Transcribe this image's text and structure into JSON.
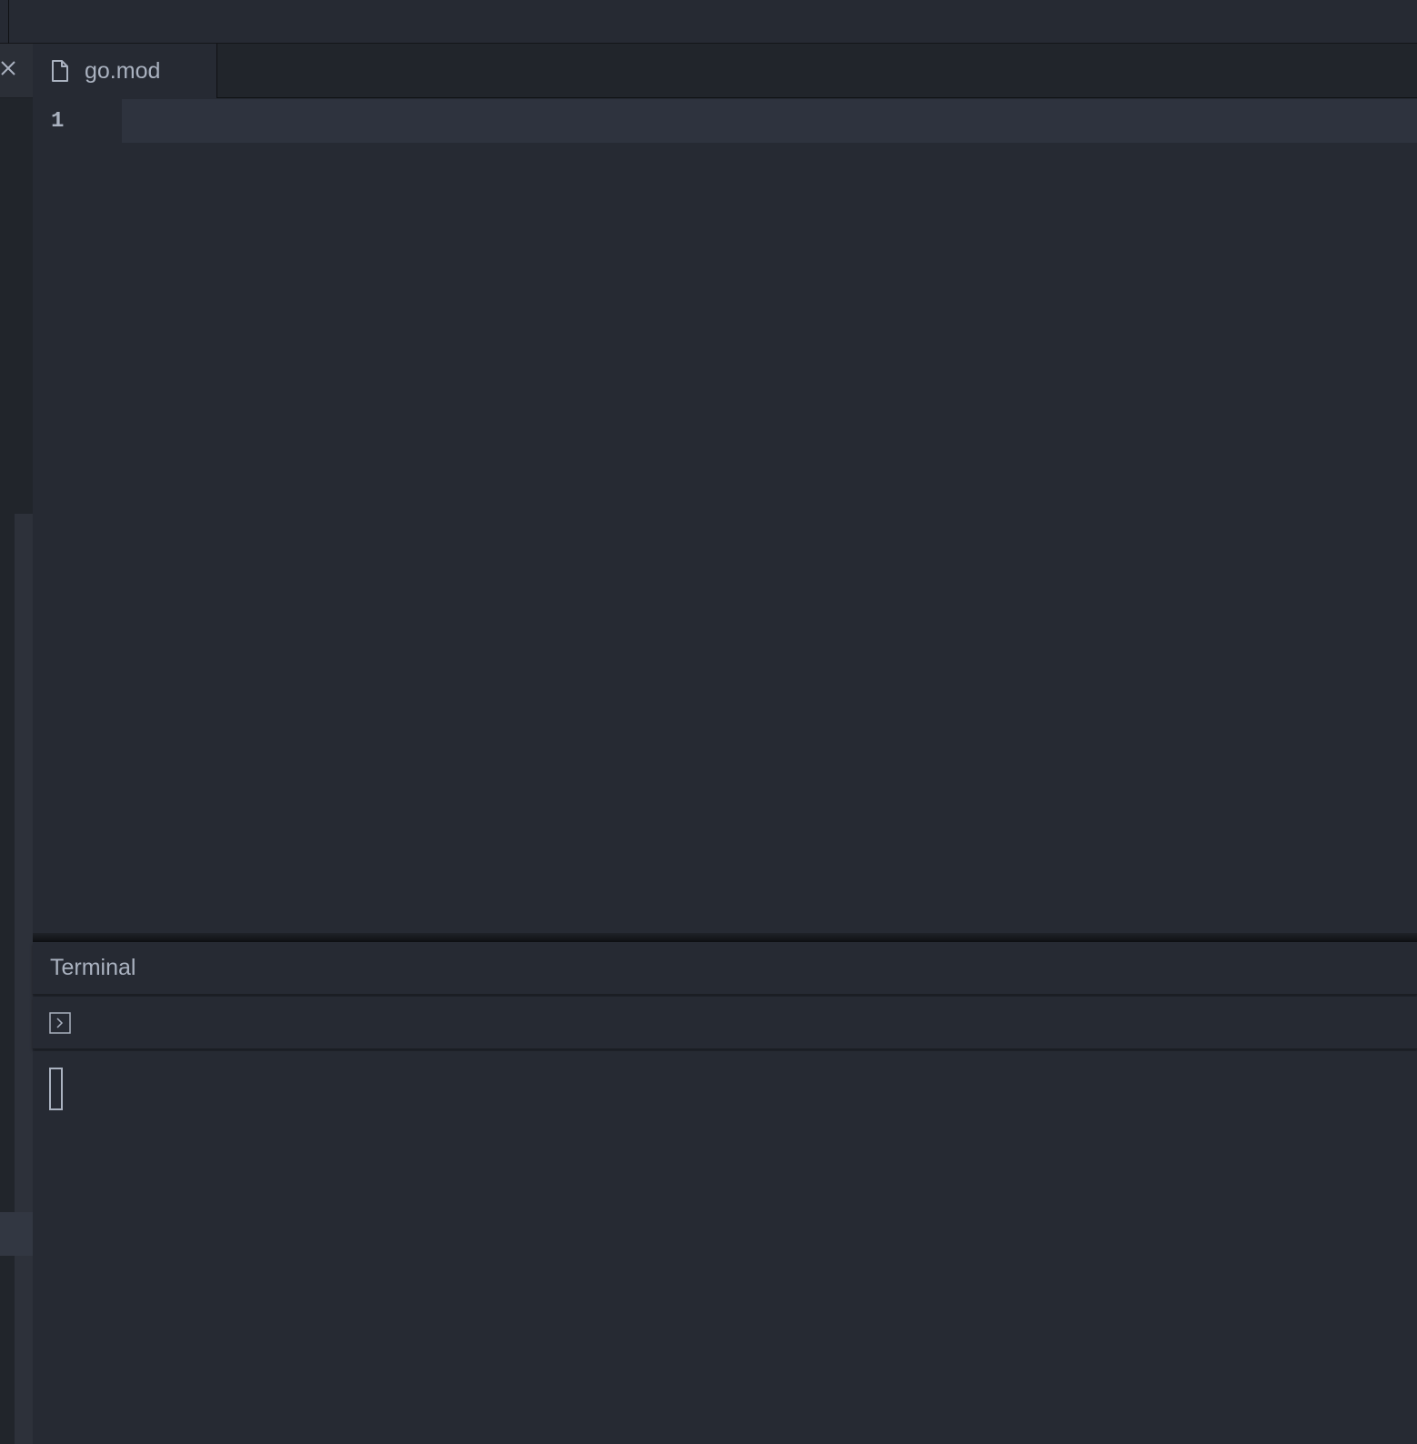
{
  "tabs": [
    {
      "label": "go.mod",
      "icon": "file-icon",
      "active": true
    }
  ],
  "editor": {
    "line_numbers": [
      "1"
    ],
    "lines": [
      ""
    ]
  },
  "terminal": {
    "title": "Terminal",
    "toolbar_icon": "terminal-prompt-icon",
    "content": ""
  },
  "colors": {
    "background": "#262a33",
    "sidebar": "#21252b",
    "text": "#aab2c0",
    "current_line": "#2e333e"
  }
}
